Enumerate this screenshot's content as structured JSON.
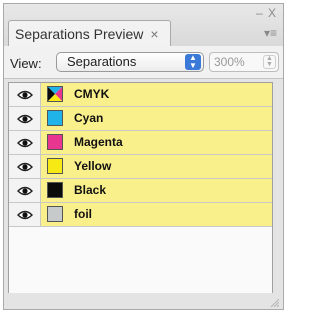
{
  "panel": {
    "tab_title": "Separations Preview",
    "tab_close_glyph": "×",
    "window_controls": "– X",
    "menu_glyph": "▾≡"
  },
  "view": {
    "label": "View:",
    "selected": "Separations",
    "zoom": "300%"
  },
  "separations": [
    {
      "name": "CMYK",
      "swatch": "cmyk-composite-icon"
    },
    {
      "name": "Cyan",
      "swatch": "#1fb3ea"
    },
    {
      "name": "Magenta",
      "swatch": "#e8358f"
    },
    {
      "name": "Yellow",
      "swatch": "#f7ea14"
    },
    {
      "name": "Black",
      "swatch": "#0a0a0a"
    },
    {
      "name": "foil",
      "swatch": "#c7cacb"
    }
  ],
  "colors": {
    "row_highlight": "#faf08b",
    "select_arrow": "#3b79d9"
  }
}
